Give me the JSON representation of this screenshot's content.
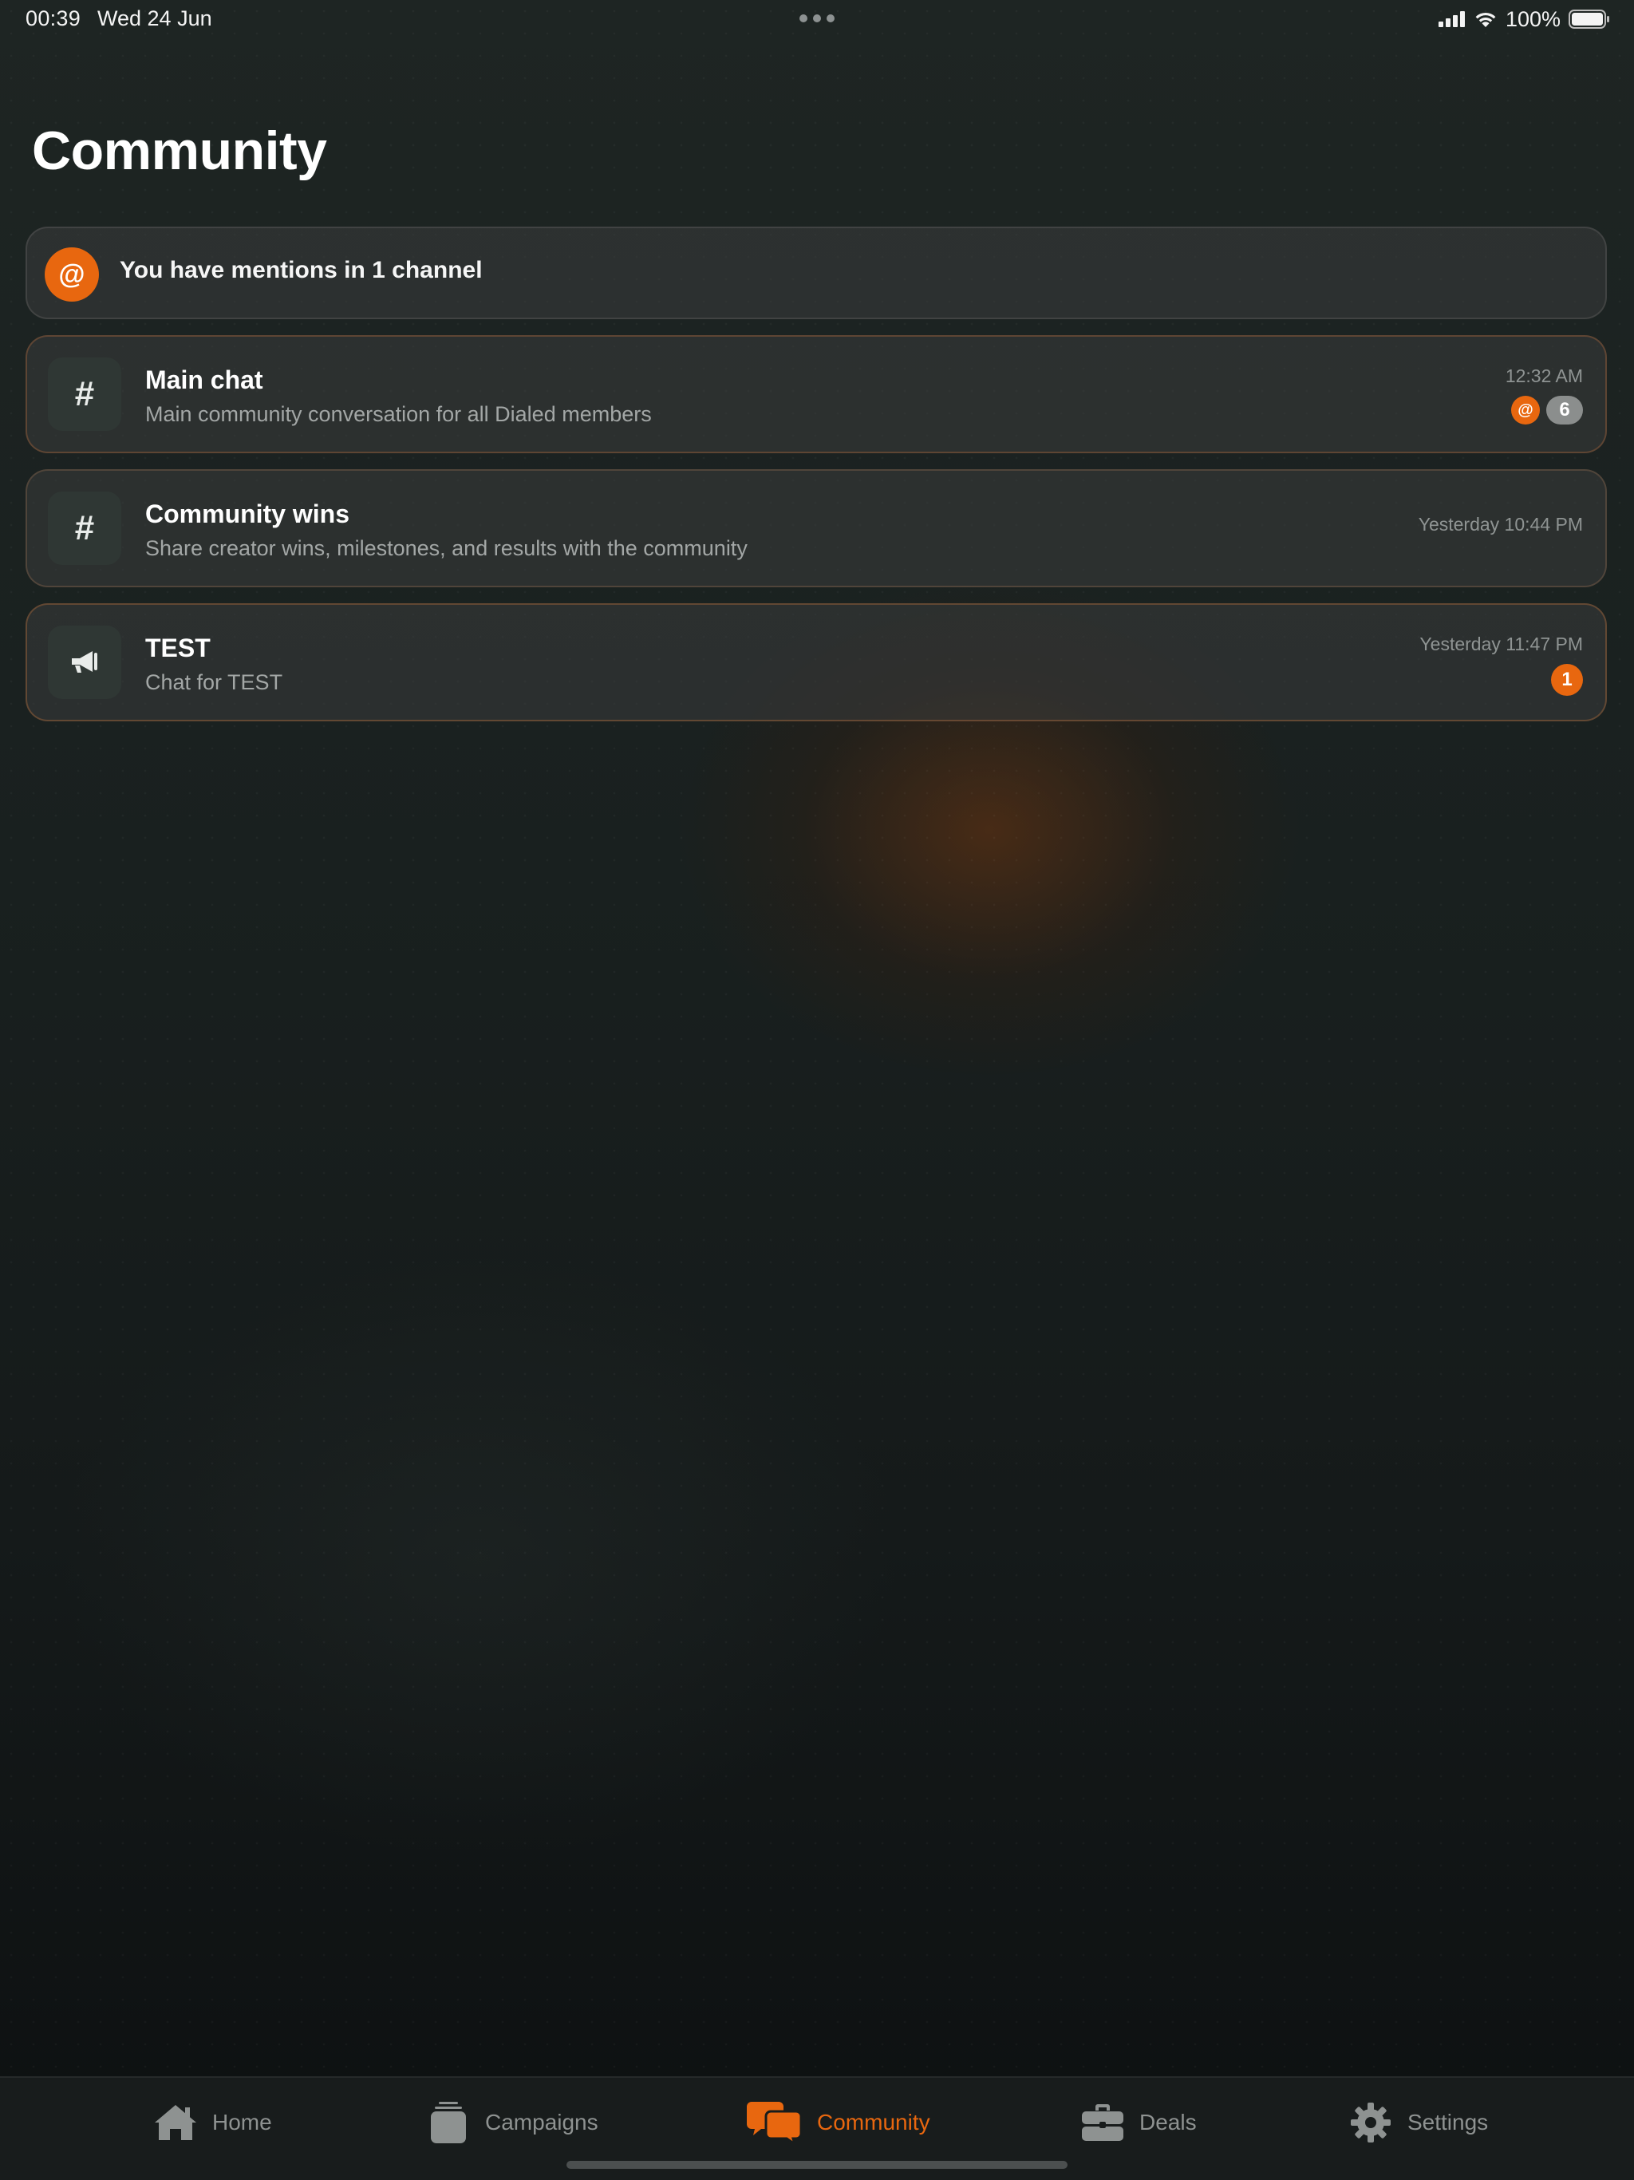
{
  "status_bar": {
    "time": "00:39",
    "date": "Wed 24 Jun",
    "battery": "100%"
  },
  "page": {
    "title": "Community"
  },
  "mentions_banner": {
    "icon": "@",
    "text": "You have mentions in 1 channel"
  },
  "channels": [
    {
      "icon": "#",
      "name": "Main chat",
      "description": "Main community conversation for all Dialed members",
      "time": "12:32 AM",
      "mention_badge": "@",
      "unread_count": "6"
    },
    {
      "icon": "#",
      "name": "Community wins",
      "description": "Share creator wins, milestones, and results with the community",
      "time": "Yesterday 10:44 PM"
    },
    {
      "icon": "megaphone-icon",
      "name": "TEST",
      "description": "Chat for TEST",
      "time": "Yesterday 11:47 PM",
      "unread_count": "1"
    }
  ],
  "tab_bar": {
    "tabs": [
      {
        "label": "Home",
        "icon": "home-icon"
      },
      {
        "label": "Campaigns",
        "icon": "campaigns-icon"
      },
      {
        "label": "Community",
        "icon": "chat-bubbles-icon",
        "active": true
      },
      {
        "label": "Deals",
        "icon": "briefcase-icon"
      },
      {
        "label": "Settings",
        "icon": "gear-icon"
      }
    ]
  },
  "colors": {
    "accent": "#e8670f",
    "background": "#19201f",
    "card": "#333636",
    "muted_text": "#a3a7a6"
  }
}
